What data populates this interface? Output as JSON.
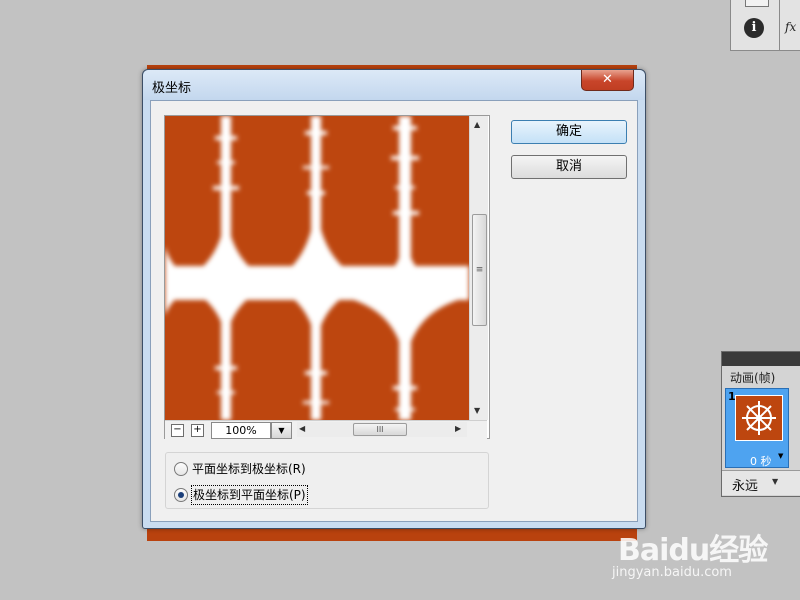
{
  "dialog": {
    "title": "极坐标",
    "close_glyph": "✕",
    "ok_label": "确定",
    "cancel_label": "取消"
  },
  "preview": {
    "zoom_minus": "−",
    "zoom_plus": "+",
    "zoom_level": "100%",
    "dropdown_glyph": "▼",
    "up_arrow": "▲",
    "down_arrow": "▼",
    "left_arrow": "◀",
    "right_arrow": "▶",
    "v_grip": "≡",
    "h_grip": "III"
  },
  "options": [
    {
      "label": "平面坐标到极坐标(R)",
      "selected": false
    },
    {
      "label": "极坐标到平面坐标(P)",
      "selected": true
    }
  ],
  "top_panel": {
    "info_glyph": "i",
    "fx_glyph": "fx"
  },
  "animation_panel": {
    "title": "动画(帧)",
    "frame_number": "1",
    "frame_time": "0 秒",
    "time_arrow": "▼",
    "loop_label": "永远",
    "loop_arrow": "▼"
  },
  "watermark": {
    "logo": "Baidu经验",
    "site": "jingyan.baidu.com"
  },
  "colors": {
    "artwork": "#bd460f",
    "accent": "#3c7fb1"
  }
}
